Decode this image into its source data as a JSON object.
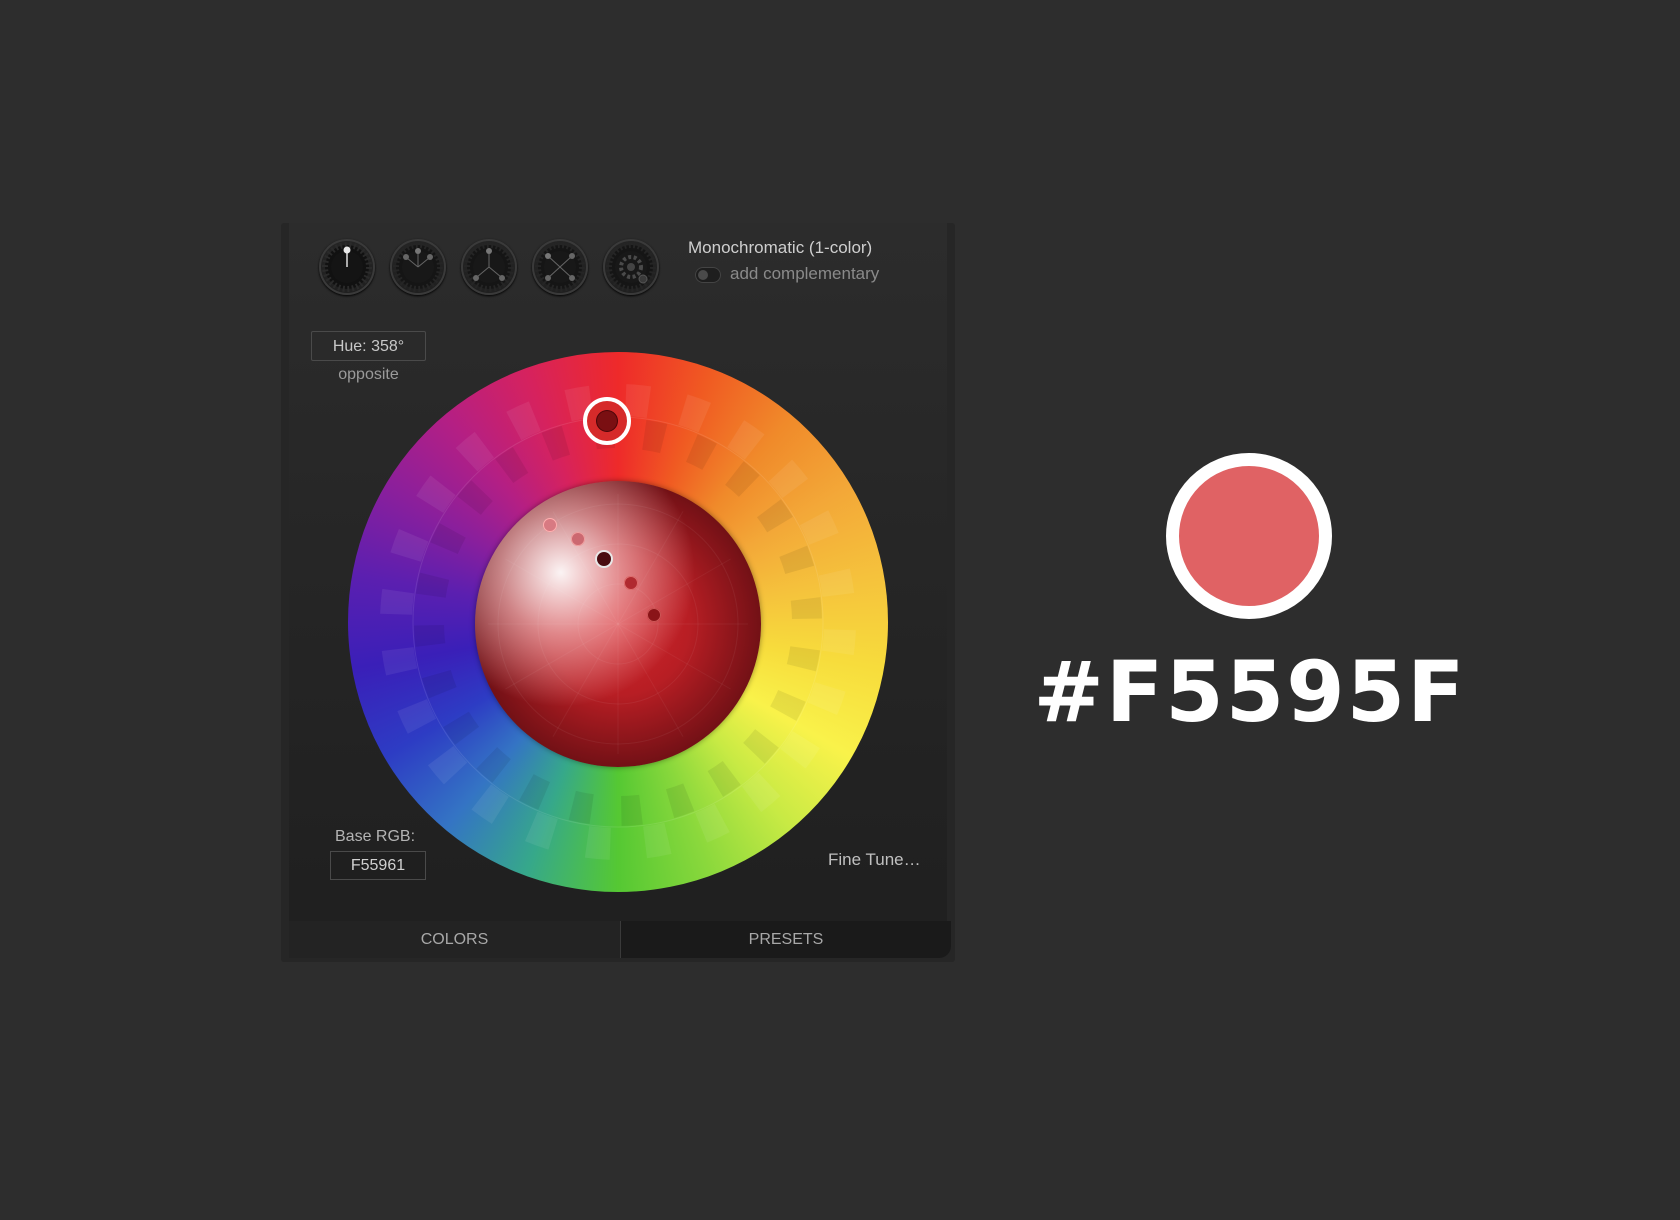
{
  "picker": {
    "scheme_title": "Monochromatic (1-color)",
    "complement_label": "add complementary",
    "schemes": [
      "monochromatic-icon",
      "analogic-icon",
      "triad-icon",
      "tetrad-icon",
      "custom-icon"
    ],
    "hue_label": "Hue: 358°",
    "opposite_label": "opposite",
    "base_rgb_label": "Base RGB:",
    "base_rgb_value": "F55961",
    "fine_tune_label": "Fine Tune…",
    "tabs": {
      "colors": "COLORS",
      "presets": "PRESETS"
    },
    "selected_tab": "COLORS",
    "hue_degrees": 358
  },
  "swatch": {
    "hex_label": "#F5595F",
    "color": "#e06264"
  }
}
